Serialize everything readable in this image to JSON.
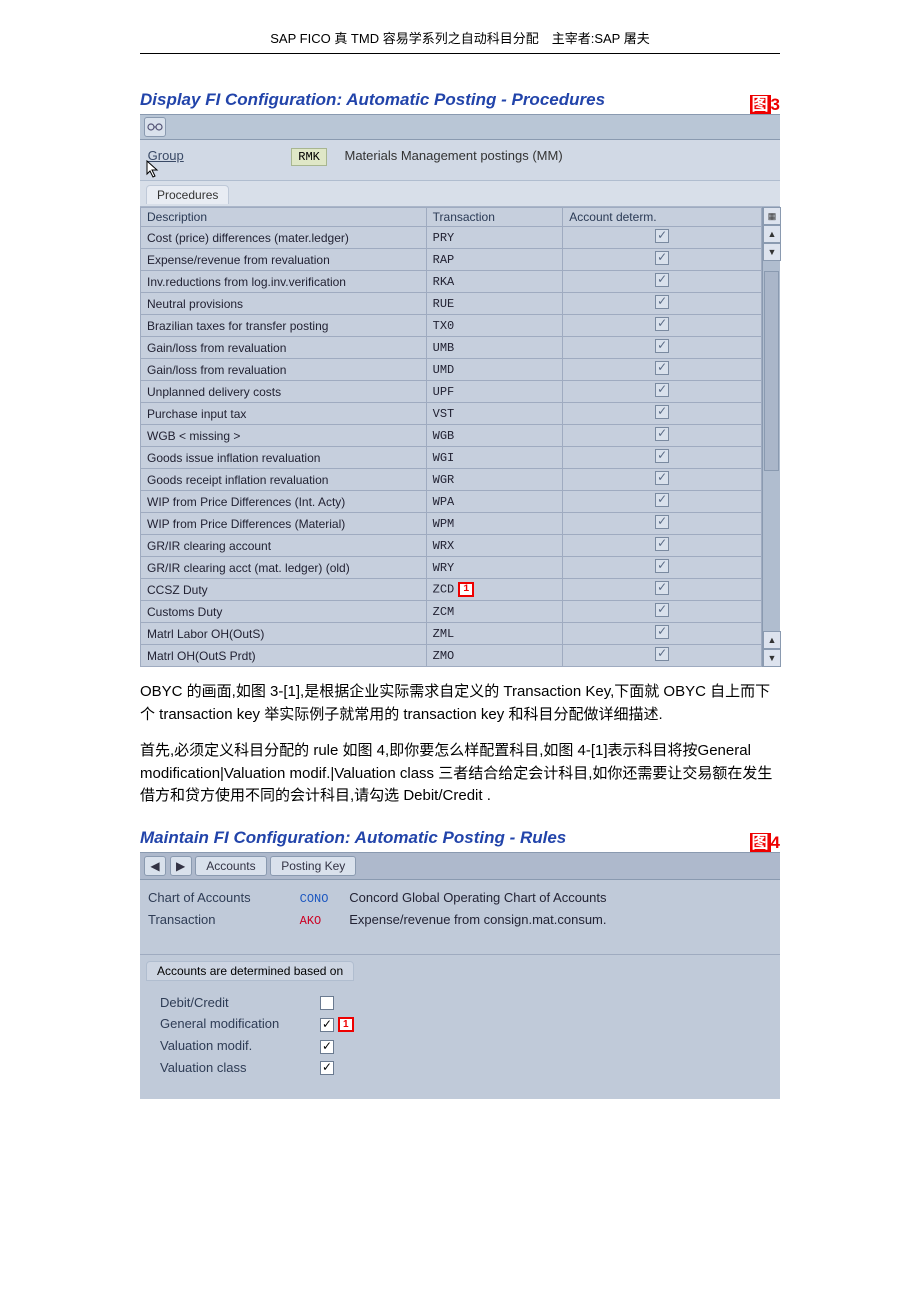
{
  "doc_header": "SAP FICO 真 TMD 容易学系列之自动科目分配　主宰者:SAP 屠夫",
  "fig3": {
    "title": "Display FI Configuration: Automatic Posting - Procedures",
    "fig_label_prefix": "图",
    "fig_label_num": "3",
    "group_label": "Group",
    "group_code": "RMK",
    "group_desc": "Materials Management postings (MM)",
    "tab_label": "Procedures",
    "headers": {
      "desc": "Description",
      "tx": "Transaction",
      "acct": "Account determ."
    },
    "callout_1": "1",
    "rows": [
      {
        "desc": "Cost (price) differences (mater.ledger)",
        "tx": "PRY",
        "acct": true
      },
      {
        "desc": "Expense/revenue from revaluation",
        "tx": "RAP",
        "acct": true
      },
      {
        "desc": "Inv.reductions from log.inv.verification",
        "tx": "RKA",
        "acct": true
      },
      {
        "desc": "Neutral provisions",
        "tx": "RUE",
        "acct": true
      },
      {
        "desc": "Brazilian taxes for transfer posting",
        "tx": "TX0",
        "acct": true
      },
      {
        "desc": "Gain/loss from revaluation",
        "tx": "UMB",
        "acct": true
      },
      {
        "desc": "Gain/loss from revaluation",
        "tx": "UMD",
        "acct": true
      },
      {
        "desc": "Unplanned delivery costs",
        "tx": "UPF",
        "acct": true
      },
      {
        "desc": "Purchase input tax",
        "tx": "VST",
        "acct": true
      },
      {
        "desc": "WGB < missing >",
        "tx": "WGB",
        "acct": true
      },
      {
        "desc": "Goods issue inflation revaluation",
        "tx": "WGI",
        "acct": true
      },
      {
        "desc": "Goods receipt inflation revaluation",
        "tx": "WGR",
        "acct": true
      },
      {
        "desc": "WIP from Price Differences (Int. Acty)",
        "tx": "WPA",
        "acct": true
      },
      {
        "desc": "WIP from Price Differences (Material)",
        "tx": "WPM",
        "acct": true
      },
      {
        "desc": "GR/IR clearing account",
        "tx": "WRX",
        "acct": true
      },
      {
        "desc": "GR/IR clearing acct (mat. ledger) (old)",
        "tx": "WRY",
        "acct": true
      },
      {
        "desc": "CCSZ Duty",
        "tx": "ZCD",
        "acct": true,
        "callout": true
      },
      {
        "desc": "Customs Duty",
        "tx": "ZCM",
        "acct": true
      },
      {
        "desc": "Matrl Labor OH(OutS)",
        "tx": "ZML",
        "acct": true
      },
      {
        "desc": "Matrl  OH(OutS Prdt)",
        "tx": "ZMO",
        "acct": true
      }
    ]
  },
  "para1": "OBYC 的画面,如图 3-[1],是根据企业实际需求自定义的 Transaction  Key,下面就 OBYC 自上而下个 transaction key 举实际例子就常用的 transaction key 和科目分配做详细描述.",
  "para2": "首先,必须定义科目分配的 rule 如图 4,即你要怎么样配置科目,如图 4-[1]表示科目将按General modification|Valuation modif.|Valuation class 三者结合给定会计科目,如你还需要让交易额在发生借方和贷方使用不同的会计科目,请勾选 Debit/Credit .",
  "fig4": {
    "title": "Maintain FI Configuration: Automatic Posting - Rules",
    "fig_label_prefix": "图",
    "fig_label_num": "4",
    "btn_accounts": "Accounts",
    "btn_postingkey": "Posting Key",
    "coa_label": "Chart of Accounts",
    "coa_code": "CONO",
    "coa_desc": "Concord Global Operating Chart of Accounts",
    "tx_label": "Transaction",
    "tx_code": "AKO",
    "tx_desc": "Expense/revenue from consign.mat.consum.",
    "box_title": "Accounts are determined based on",
    "callout_1": "1",
    "rules": [
      {
        "label": "Debit/Credit",
        "checked": false
      },
      {
        "label": "General modification",
        "checked": true,
        "callout": true
      },
      {
        "label": "Valuation modif.",
        "checked": true
      },
      {
        "label": "Valuation class",
        "checked": true
      }
    ]
  }
}
